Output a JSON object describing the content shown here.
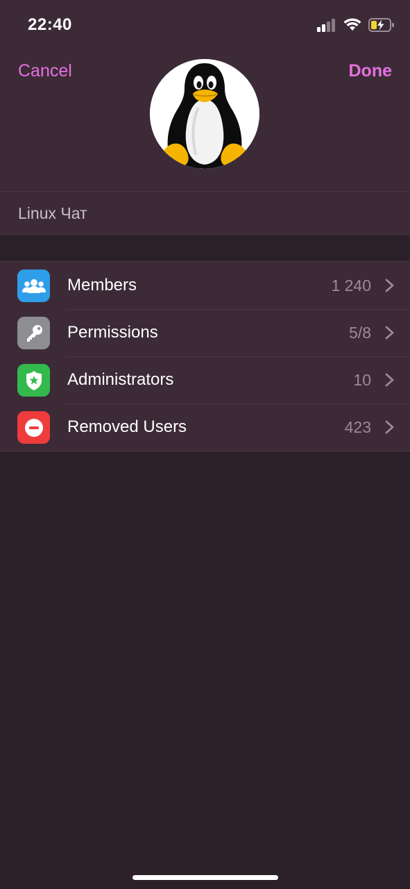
{
  "status_bar": {
    "time": "22:40"
  },
  "nav": {
    "cancel_label": "Cancel",
    "done_label": "Done"
  },
  "group": {
    "name": "Linux Чат"
  },
  "menu": [
    {
      "label": "Members",
      "value": "1 240",
      "icon": "members-icon",
      "color": "#2f9ee8"
    },
    {
      "label": "Permissions",
      "value": "5/8",
      "icon": "key-icon",
      "color": "#8d8d92"
    },
    {
      "label": "Administrators",
      "value": "10",
      "icon": "shield-icon",
      "color": "#34b94d"
    },
    {
      "label": "Removed Users",
      "value": "423",
      "icon": "remove-icon",
      "color": "#ee3c3c"
    }
  ],
  "colors": {
    "accent": "#e66fe0",
    "background": "#2d2129",
    "surface": "#3c2b37"
  }
}
